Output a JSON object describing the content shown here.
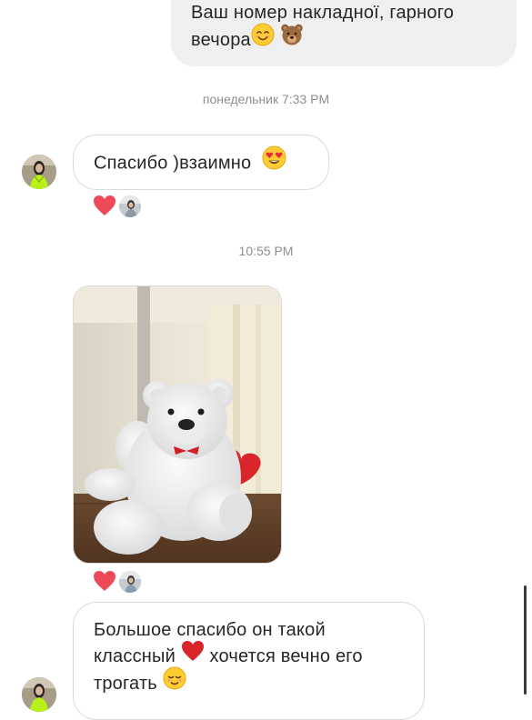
{
  "messages": {
    "outgoing_1": {
      "line1": "Ваш номер накладної, гарного",
      "line2": "вечора",
      "emoji": [
        "smiling-face-icon",
        "bear-face-icon"
      ]
    },
    "timestamp_1": "понедельник 7:33 PM",
    "incoming_1": {
      "text": "Спасибо )взаимно",
      "emoji": "heart-eyes-face-icon"
    },
    "timestamp_2": "10:55 PM",
    "incoming_photo": {
      "subject": "white-teddy-bear-photo"
    },
    "incoming_2": {
      "line1": "Большое спасибо он такой",
      "line2_before": "классный",
      "line2_after": "хочется вечно его",
      "line3": "трогать"
    }
  },
  "colors": {
    "outgoing_bubble": "#efefef",
    "incoming_border": "#dbdbdb",
    "reaction_heart": "#ed4956",
    "timestamp": "#8e8e8e"
  }
}
